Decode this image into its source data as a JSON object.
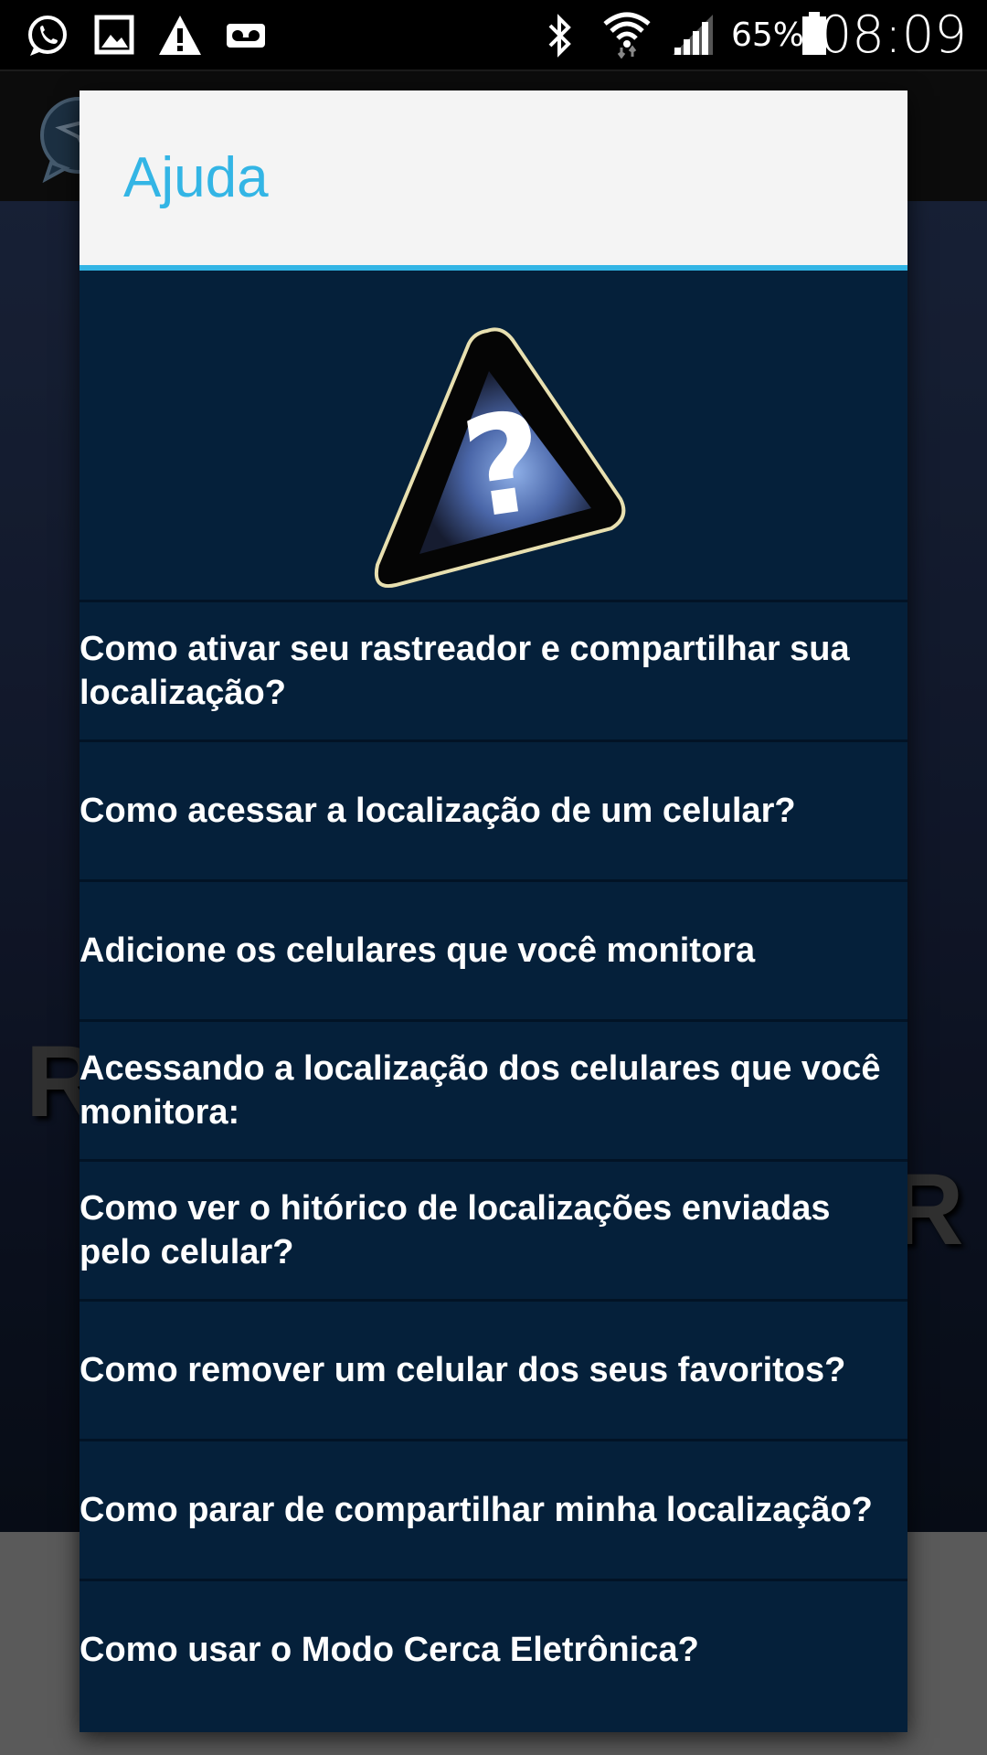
{
  "status_bar": {
    "battery_percent": "65%",
    "time": "08:09",
    "icons": [
      "whatsapp-icon",
      "image-icon",
      "warning-icon",
      "voicemail-icon",
      "bluetooth-icon",
      "wifi-icon",
      "signal-icon",
      "battery-icon"
    ]
  },
  "background": {
    "ghost_left": "R",
    "ghost_right": "R"
  },
  "dialog": {
    "title": "Ajuda",
    "accent_color": "#33b5e5",
    "icon": "help-question-icon",
    "topics": [
      {
        "label": "Como ativar seu rastreador e compartilhar sua localização?"
      },
      {
        "label": "Como acessar a localização de um celular?"
      },
      {
        "label": "Adicione os celulares que você monitora"
      },
      {
        "label": "Acessando a localização dos celulares que você monitora:"
      },
      {
        "label": "Como ver o hitórico de localizações enviadas pelo celular?"
      },
      {
        "label": "Como remover um celular dos seus favoritos?"
      },
      {
        "label": "Como parar de compartilhar minha localização?"
      },
      {
        "label": "Como usar o Modo Cerca Eletrônica?"
      }
    ]
  }
}
